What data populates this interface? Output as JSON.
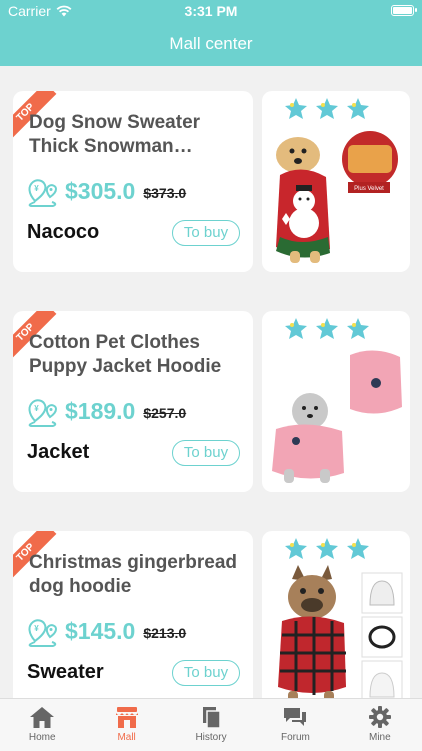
{
  "status": {
    "carrier": "Carrier",
    "time": "3:31 PM"
  },
  "header": {
    "title": "Mall center"
  },
  "products": [
    {
      "badge": "TOP",
      "name": "Dog Snow Sweater Thick Snowman Sweater",
      "price": "$305.0",
      "original_price": "$373.0",
      "category": "Nacoco",
      "buy_label": "To buy",
      "photo_caption": "Plus Velvet"
    },
    {
      "badge": "TOP",
      "name": "Cotton Pet Clothes Puppy Jacket Hoodie",
      "price": "$189.0",
      "original_price": "$257.0",
      "category": "Jacket",
      "buy_label": "To buy"
    },
    {
      "badge": "TOP",
      "name": "Christmas gingerbread dog hoodie",
      "price": "$145.0",
      "original_price": "$213.0",
      "category": "Sweater",
      "buy_label": "To buy"
    }
  ],
  "tabs": [
    {
      "label": "Home",
      "icon": "home-icon"
    },
    {
      "label": "Mall",
      "icon": "store-icon",
      "active": true
    },
    {
      "label": "History",
      "icon": "history-icon"
    },
    {
      "label": "Forum",
      "icon": "forum-icon"
    },
    {
      "label": "Mine",
      "icon": "gear-icon"
    }
  ],
  "colors": {
    "accent": "#6dd2cf",
    "badge": "#f06b4a",
    "active_tab": "#f06b4a"
  }
}
